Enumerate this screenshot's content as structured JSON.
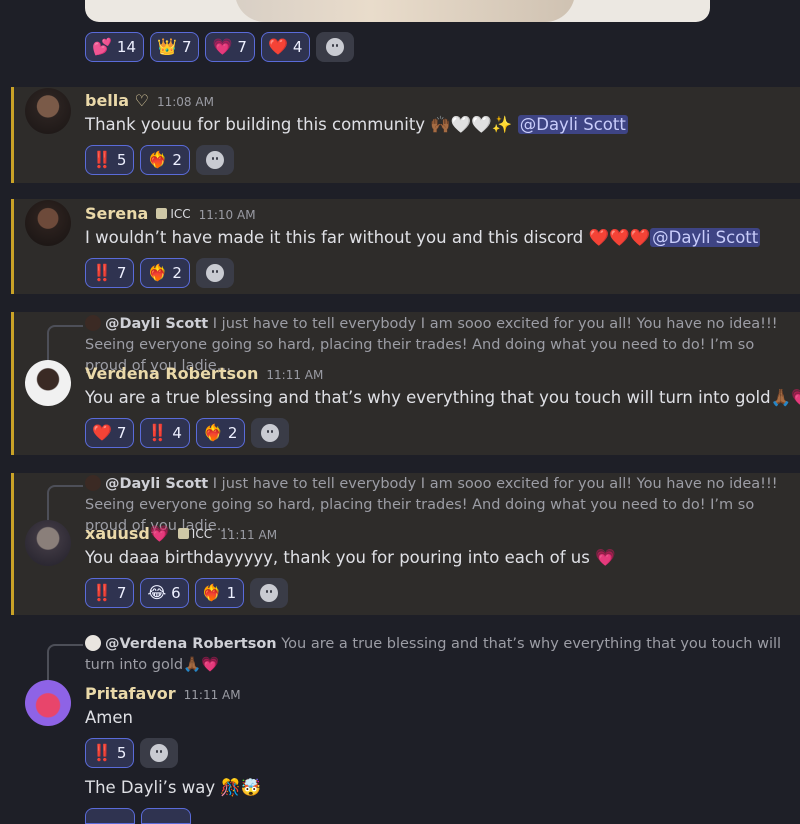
{
  "top_reactions": [
    {
      "emoji": "💕",
      "count": "14"
    },
    {
      "emoji": "👑",
      "count": "7"
    },
    {
      "emoji": "💗",
      "count": "7"
    },
    {
      "emoji": "❤️",
      "count": "4"
    }
  ],
  "messages": [
    {
      "author": "bella ♡",
      "time": "11:08 AM",
      "text": "Thank youuu for building this community 🙌🏾🤍🤍✨",
      "mention": "@Dayli Scott",
      "reactions": [
        {
          "emoji": "‼️",
          "count": "5"
        },
        {
          "emoji": "❤️‍🔥",
          "count": "2"
        }
      ]
    },
    {
      "author": "Serena",
      "tag": "ICC",
      "time": "11:10 AM",
      "text": "I wouldn’t have made it this far without you and this discord ❤️❤️❤️",
      "mention": "@Dayli Scott",
      "reactions": [
        {
          "emoji": "‼️",
          "count": "7"
        },
        {
          "emoji": "❤️‍🔥",
          "count": "2"
        }
      ]
    },
    {
      "reply_name": "@Dayli Scott",
      "reply_text": "I just have to tell everybody I am sooo excited for you all! You have no idea!!! Seeing everyone going so hard, placing their trades! And doing what you need to do! I’m so proud of you ladie…",
      "author": "Verdena Robertson",
      "time": "11:11 AM",
      "text": "You are a true blessing and that’s why everything that you touch will turn into gold🙏🏾💗",
      "reactions": [
        {
          "emoji": "❤️",
          "count": "7"
        },
        {
          "emoji": "‼️",
          "count": "4"
        },
        {
          "emoji": "❤️‍🔥",
          "count": "2"
        }
      ]
    },
    {
      "reply_name": "@Dayli Scott",
      "reply_text": "I just have to tell everybody I am sooo excited for you all! You have no idea!!! Seeing everyone going so hard, placing their trades! And doing what you need to do! I’m so proud of you ladie…",
      "author": "xauusd💗",
      "tag": "ICC",
      "time": "11:11 AM",
      "text": "You daaa birthdayyyyy, thank you for pouring into each of us 💗",
      "reactions": [
        {
          "emoji": "‼️",
          "count": "7"
        },
        {
          "emoji": "😂",
          "count": "6"
        },
        {
          "emoji": "❤️‍🔥",
          "count": "1"
        }
      ]
    },
    {
      "reply_name": "@Verdena Robertson",
      "reply_text": "You are a true blessing and that’s why everything that you touch will turn into gold🙏🏾💗",
      "author": "Pritafavor",
      "time": "11:11 AM",
      "text": "Amen",
      "reactions": [
        {
          "emoji": "‼️",
          "count": "5"
        }
      ],
      "followup": "The Dayli’s way 🎊🤯"
    }
  ],
  "colors": {
    "mention_bg": "#3e4484",
    "highlight_border": "#c9a227",
    "reaction_border": "#5a6bd9"
  }
}
